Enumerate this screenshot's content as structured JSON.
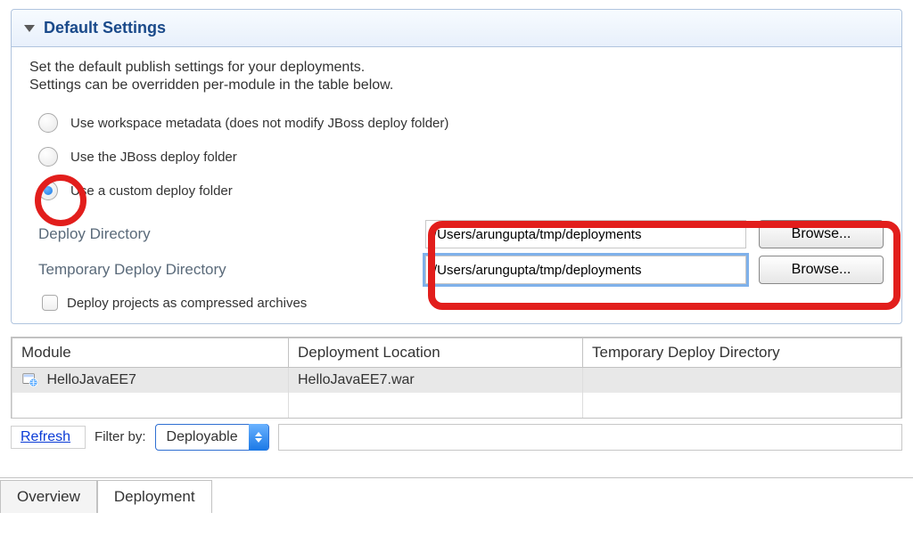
{
  "panel": {
    "title": "Default Settings",
    "desc1": "Set the default publish settings for your deployments.",
    "desc2": "Settings can be overridden per-module in the table below."
  },
  "radios": {
    "opt1": "Use workspace metadata (does not modify JBoss deploy folder)",
    "opt2": "Use the JBoss deploy folder",
    "opt3": "Use a custom deploy folder"
  },
  "dirs": {
    "deploy_label": "Deploy Directory",
    "deploy_value": "/Users/arungupta/tmp/deployments",
    "deploy_browse": "Browse...",
    "temp_label": "Temporary Deploy Directory",
    "temp_value": "/Users/arungupta/tmp/deployments",
    "temp_browse": "Browse..."
  },
  "checkbox": {
    "label": "Deploy projects as compressed archives"
  },
  "table": {
    "headers": {
      "module": "Module",
      "location": "Deployment Location",
      "temp": "Temporary Deploy Directory"
    },
    "row": {
      "module": "HelloJavaEE7",
      "location": "HelloJavaEE7.war",
      "temp": ""
    }
  },
  "filter": {
    "refresh": "Refresh",
    "filter_by": "Filter by:",
    "select_value": "Deployable"
  },
  "tabs": {
    "overview": "Overview",
    "deployment": "Deployment"
  }
}
